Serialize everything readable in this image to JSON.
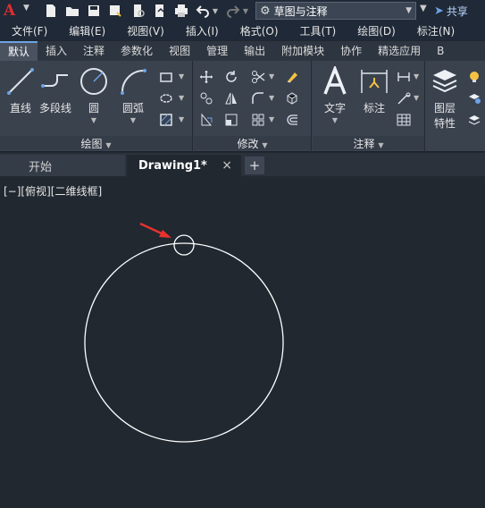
{
  "app": {
    "logo_letter": "A",
    "workspace": "草图与注释",
    "share_label": "共享"
  },
  "menu": [
    "文件(F)",
    "编辑(E)",
    "视图(V)",
    "插入(I)",
    "格式(O)",
    "工具(T)",
    "绘图(D)",
    "标注(N)"
  ],
  "ribbon_tabs": [
    "默认",
    "插入",
    "注释",
    "参数化",
    "视图",
    "管理",
    "输出",
    "附加模块",
    "协作",
    "精选应用",
    "B"
  ],
  "draw_panel": {
    "title": "绘图",
    "line": "直线",
    "polyline": "多段线",
    "circle": "圆",
    "arc": "圆弧"
  },
  "modify_panel": {
    "title": "修改"
  },
  "annotation_panel": {
    "title": "注释",
    "text": "文字",
    "dimension": "标注"
  },
  "layers_panel": {
    "label_line1": "图层",
    "label_line2": "特性"
  },
  "doc_tabs": {
    "start": "开始",
    "drawing": "Drawing1*",
    "close": "×",
    "add": "+"
  },
  "viewport_label": "[−][俯视][二维线框]",
  "colors": {
    "background": "#212830",
    "geometry": "#ffffff",
    "arrow": "#e8322d",
    "accent": "#6ba3e6"
  }
}
